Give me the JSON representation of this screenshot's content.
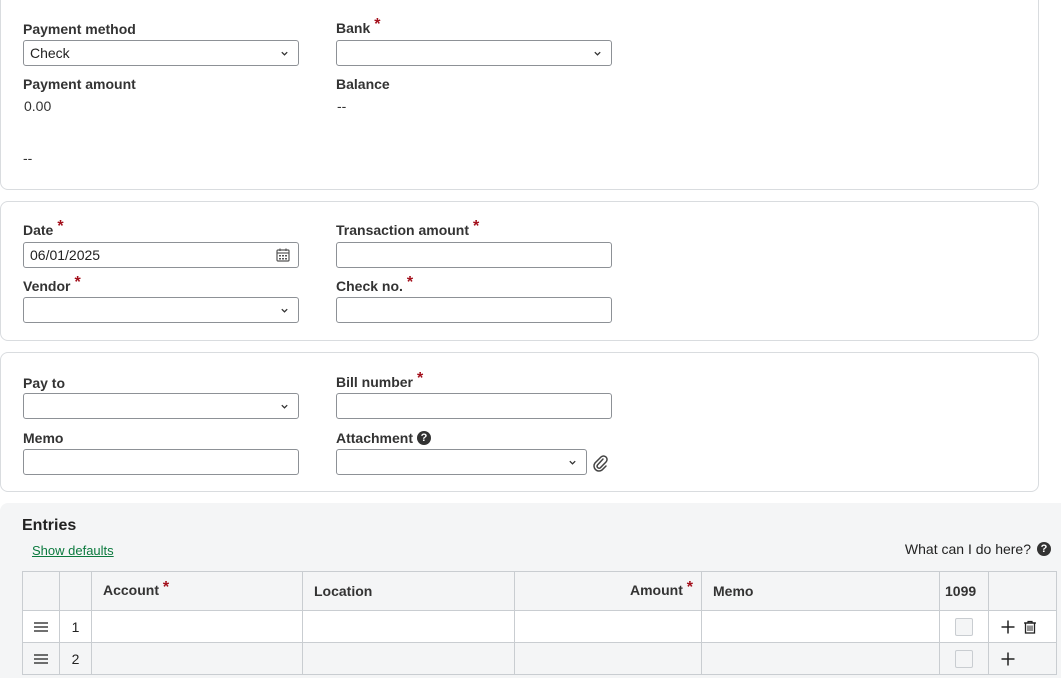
{
  "payment": {
    "method_label": "Payment method",
    "method_value": "Check",
    "bank_label": "Bank",
    "bank_value": "",
    "amount_label": "Payment amount",
    "amount_value": "0.00",
    "balance_label": "Balance",
    "balance_value": "--",
    "extra_value": "--"
  },
  "details": {
    "date_label": "Date",
    "date_value": "06/01/2025",
    "txn_amount_label": "Transaction amount",
    "txn_amount_value": "",
    "vendor_label": "Vendor",
    "vendor_value": "",
    "check_no_label": "Check no.",
    "check_no_value": ""
  },
  "payto": {
    "pay_to_label": "Pay to",
    "pay_to_value": "",
    "bill_number_label": "Bill number",
    "bill_number_value": "",
    "memo_label": "Memo",
    "memo_value": "",
    "attachment_label": "Attachment",
    "attachment_value": ""
  },
  "required_mark": "*",
  "help_glyph": "?",
  "entries": {
    "title": "Entries",
    "show_defaults": "Show defaults",
    "help_text": "What can I do here?",
    "columns": {
      "account": "Account",
      "location": "Location",
      "amount": "Amount",
      "memo": "Memo",
      "form1099": "1099"
    },
    "rows": [
      {
        "num": "1"
      },
      {
        "num": "2"
      }
    ]
  },
  "colors": {
    "required": "#a30f1b",
    "link": "#0b7a3e",
    "border": "#8d9196"
  },
  "icons": [
    "chevron-down-icon",
    "calendar-icon",
    "help-icon",
    "paperclip-icon",
    "drag-handle-icon",
    "plus-icon",
    "trash-icon"
  ]
}
